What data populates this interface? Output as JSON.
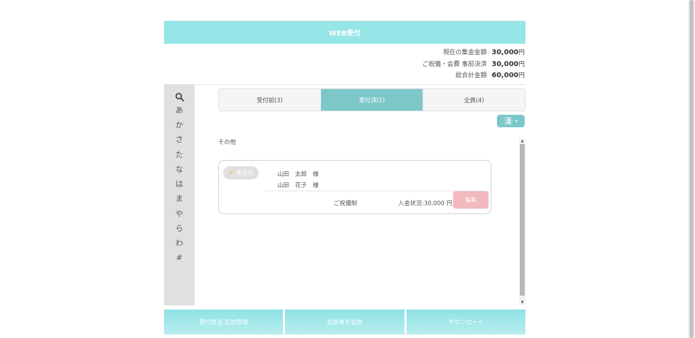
{
  "header": {
    "title": "WEB受付"
  },
  "summary": [
    {
      "label": "現在の集金金額",
      "value": "30,000",
      "unit": "円"
    },
    {
      "label": "ご祝儀・会費 事前決済",
      "value": "30,000",
      "unit": "円"
    },
    {
      "label": "総合計金額",
      "value": "60,000",
      "unit": "円"
    }
  ],
  "kana_index": {
    "search_icon": "search-icon",
    "items": [
      "あ",
      "か",
      "さ",
      "た",
      "な",
      "は",
      "ま",
      "や",
      "ら",
      "わ",
      "#"
    ]
  },
  "tabs": [
    {
      "label": "受付前(3)",
      "active": false
    },
    {
      "label": "受付済(1)",
      "active": true
    },
    {
      "label": "全員(4)",
      "active": false
    }
  ],
  "kanji_dropdown": {
    "label": "漢",
    "caret": "▾"
  },
  "group": {
    "label": "その他"
  },
  "card": {
    "badge_check": "✔",
    "badge_label": "未返信",
    "guests": [
      "山田　太郎　様",
      "山田　花子　様"
    ],
    "gift_type": "ご祝儀制",
    "payment_status": "入金状況:30,000 円",
    "edit_label": "編集"
  },
  "footer": {
    "buttons": [
      "受付担当 追加登録",
      "出席者を追加",
      "ダウンロード"
    ]
  },
  "colors": {
    "header_bg": "#96e5e7",
    "tab_active": "#7cc8c9",
    "edit_button": "#f2b9be",
    "badge_check": "#f1c84c"
  }
}
